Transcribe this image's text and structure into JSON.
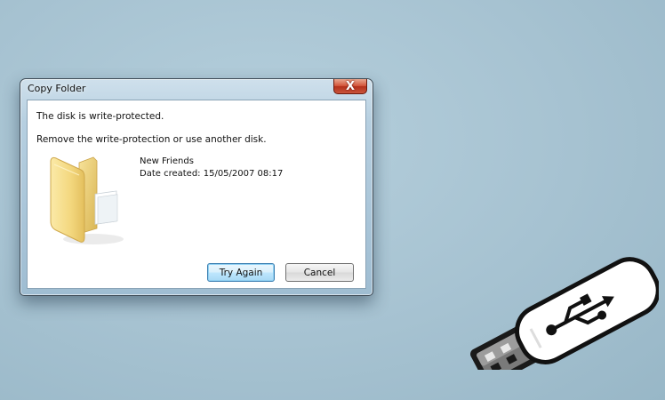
{
  "dialog": {
    "title": "Copy Folder",
    "close_glyph": "X",
    "message_line1": "The disk is write-protected.",
    "message_line2": "Remove the write-protection or use another disk.",
    "file": {
      "name": "New Friends",
      "date_created": "Date created: 15/05/2007 08:17",
      "icon": "folder-icon"
    },
    "buttons": {
      "try_again": "Try Again",
      "cancel": "Cancel"
    }
  },
  "decor": {
    "usb_icon": "usb-drive-icon"
  },
  "colors": {
    "background": "#a6c2d1",
    "close_button": "#c9432b",
    "default_button_border": "#3c7fb1"
  }
}
